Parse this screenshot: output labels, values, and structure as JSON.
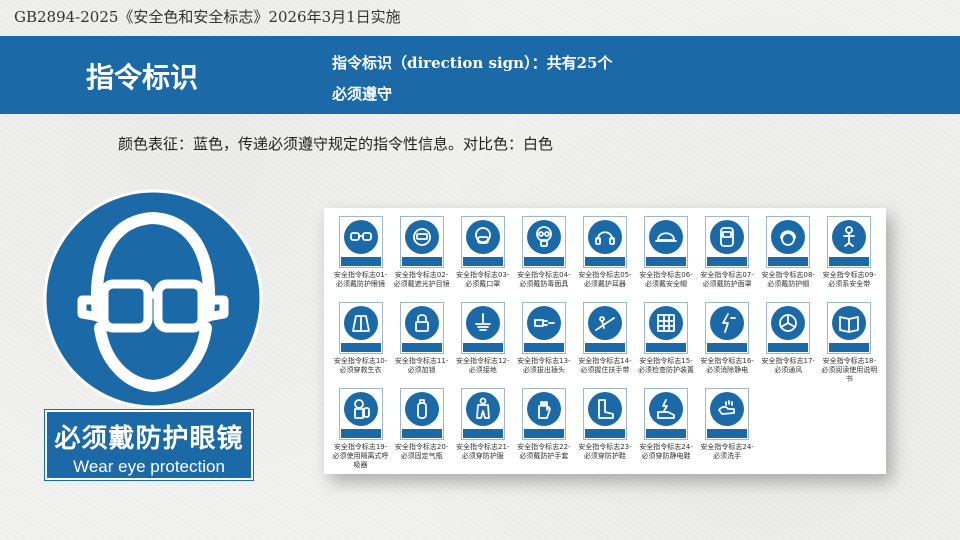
{
  "header": {
    "standard_title": "GB2894-2025《安全色和安全标志》2026年3月1日实施"
  },
  "banner": {
    "title": "指令标识",
    "desc_line1": "指令标识（direction  sign）：共有25个",
    "desc_line2": "必须遵守"
  },
  "color_note": "颜色表征：蓝色，传递必须遵守规定的指令性信息。对比色：白色",
  "featured_sign": {
    "label_cn": "必须戴防护眼镜",
    "label_en": "Wear eye protection",
    "colors": {
      "blue": "#1b6aa7",
      "white": "#ffffff"
    }
  },
  "signs": [
    {
      "icon": "goggles-icon",
      "caption": "安全指令标志01-必须戴防护眼镜"
    },
    {
      "icon": "face-shield-icon",
      "caption": "安全指令标志02-必须戴遮光护目镜"
    },
    {
      "icon": "mask-icon",
      "caption": "安全指令标志03-必须戴口罩"
    },
    {
      "icon": "gas-mask-icon",
      "caption": "安全指令标志04-必须戴防毒面具"
    },
    {
      "icon": "ear-muff-icon",
      "caption": "安全指令标志05-必须戴护耳器"
    },
    {
      "icon": "helmet-icon",
      "caption": "安全指令标志06-必须戴安全帽"
    },
    {
      "icon": "protective-hood-icon",
      "caption": "安全指令标志07-必须戴防护面罩"
    },
    {
      "icon": "hair-cap-icon",
      "caption": "安全指令标志08-必须戴防护帽"
    },
    {
      "icon": "safety-belt-icon",
      "caption": "安全指令标志09-必须系安全带"
    },
    {
      "icon": "life-jacket-icon",
      "caption": "安全指令标志10-必须穿救生衣"
    },
    {
      "icon": "padlock-icon",
      "caption": "安全指令标志11-必须加锁"
    },
    {
      "icon": "ground-icon",
      "caption": "安全指令标志12-必须接地"
    },
    {
      "icon": "unplug-icon",
      "caption": "安全指令标志13-必须拔出插头"
    },
    {
      "icon": "handrail-icon",
      "caption": "安全指令标志14-必须握住扶手带"
    },
    {
      "icon": "inspect-guard-icon",
      "caption": "安全指令标志15-必须检查防护装置"
    },
    {
      "icon": "antistatic-icon",
      "caption": "安全指令标志16-必须消除静电"
    },
    {
      "icon": "ventilation-icon",
      "caption": "安全指令标志17-必须通风"
    },
    {
      "icon": "manual-icon",
      "caption": "安全指令标志18-必须阅读使用说明书"
    },
    {
      "icon": "respirator-icon",
      "caption": "安全指令标志19-必须使用隔离式呼吸器"
    },
    {
      "icon": "gas-cylinder-icon",
      "caption": "安全指令标志20-必须固定气瓶"
    },
    {
      "icon": "coverall-icon",
      "caption": "安全指令标志21-必须穿防护服"
    },
    {
      "icon": "gloves-icon",
      "caption": "安全指令标志22-必须戴防护手套"
    },
    {
      "icon": "boots-icon",
      "caption": "安全指令标志23-必须穿防护鞋"
    },
    {
      "icon": "antistatic-shoe-icon",
      "caption": "安全指令标志24-必须穿防静电鞋"
    },
    {
      "icon": "wash-hands-icon",
      "caption": "安全指令标志24-必须洗手"
    }
  ]
}
